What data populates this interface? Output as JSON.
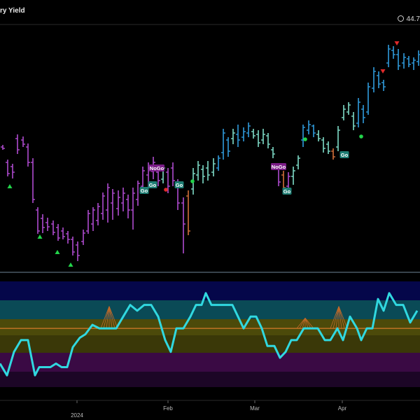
{
  "chart": {
    "title": "ry Yield",
    "last_value": "44.7"
  },
  "chart_data": [
    {
      "type": "ohlc",
      "panel": "price",
      "title": "ry Yield",
      "x_ticks": [
        "2024",
        "Feb",
        "Mar",
        "Apr"
      ],
      "bars": [
        {
          "c": "purple",
          "lo": 214,
          "hi": 207,
          "o": 210,
          "cl": 212
        },
        {
          "c": "purple",
          "lo": 252,
          "hi": 228,
          "o": 232,
          "cl": 248
        },
        {
          "c": "purple",
          "lo": 255,
          "hi": 234,
          "o": 238,
          "cl": 246
        },
        {
          "c": "purple",
          "lo": 220,
          "hi": 192,
          "o": 198,
          "cl": 214
        },
        {
          "c": "purple",
          "lo": 210,
          "hi": 195,
          "o": 200,
          "cl": 206
        },
        {
          "c": "purple",
          "lo": 238,
          "hi": 205,
          "o": 210,
          "cl": 232
        },
        {
          "c": "purple",
          "lo": 290,
          "hi": 226,
          "o": 232,
          "cl": 285
        },
        {
          "c": "purple",
          "lo": 334,
          "hi": 296,
          "o": 300,
          "cl": 330
        },
        {
          "c": "purple",
          "lo": 333,
          "hi": 306,
          "o": 312,
          "cl": 325
        },
        {
          "c": "purple",
          "lo": 330,
          "hi": 311,
          "o": 318,
          "cl": 324
        },
        {
          "c": "purple",
          "lo": 336,
          "hi": 315,
          "o": 320,
          "cl": 332
        },
        {
          "c": "purple",
          "lo": 344,
          "hi": 320,
          "o": 325,
          "cl": 340
        },
        {
          "c": "purple",
          "lo": 342,
          "hi": 325,
          "o": 330,
          "cl": 338
        },
        {
          "c": "purple",
          "lo": 348,
          "hi": 330,
          "o": 334,
          "cl": 342
        },
        {
          "c": "purple",
          "lo": 365,
          "hi": 338,
          "o": 342,
          "cl": 360
        },
        {
          "c": "purple",
          "lo": 373,
          "hi": 345,
          "o": 350,
          "cl": 365
        },
        {
          "c": "purple",
          "lo": 350,
          "hi": 328,
          "o": 345,
          "cl": 333
        },
        {
          "c": "purple",
          "lo": 334,
          "hi": 300,
          "o": 330,
          "cl": 305
        },
        {
          "c": "purple",
          "lo": 330,
          "hi": 296,
          "o": 320,
          "cl": 300
        },
        {
          "c": "purple",
          "lo": 322,
          "hi": 290,
          "o": 315,
          "cl": 295
        },
        {
          "c": "purple",
          "lo": 314,
          "hi": 275,
          "o": 305,
          "cl": 280
        },
        {
          "c": "purple",
          "lo": 318,
          "hi": 262,
          "o": 300,
          "cl": 268
        },
        {
          "c": "purple",
          "lo": 314,
          "hi": 270,
          "o": 290,
          "cl": 276
        },
        {
          "c": "purple",
          "lo": 308,
          "hi": 272,
          "o": 298,
          "cl": 282
        },
        {
          "c": "purple",
          "lo": 302,
          "hi": 268,
          "o": 290,
          "cl": 276
        },
        {
          "c": "purple",
          "lo": 312,
          "hi": 278,
          "o": 285,
          "cl": 300
        },
        {
          "c": "purple",
          "lo": 328,
          "hi": 268,
          "o": 300,
          "cl": 276
        },
        {
          "c": "purple",
          "lo": 294,
          "hi": 258,
          "o": 285,
          "cl": 262
        },
        {
          "c": "purple",
          "lo": 275,
          "hi": 238,
          "o": 266,
          "cl": 244
        },
        {
          "c": "purple",
          "lo": 268,
          "hi": 232,
          "o": 250,
          "cl": 240
        },
        {
          "c": "purple",
          "lo": 256,
          "hi": 224,
          "o": 245,
          "cl": 232
        },
        {
          "c": "purple",
          "lo": 266,
          "hi": 240,
          "o": 246,
          "cl": 258
        },
        {
          "c": "teal",
          "lo": 262,
          "hi": 236,
          "o": 256,
          "cl": 240
        },
        {
          "c": "purple",
          "lo": 276,
          "hi": 240,
          "o": 246,
          "cl": 266
        },
        {
          "c": "purple",
          "lo": 266,
          "hi": 232,
          "o": 240,
          "cl": 258
        },
        {
          "c": "purple",
          "lo": 300,
          "hi": 256,
          "o": 260,
          "cl": 290
        },
        {
          "c": "purple",
          "lo": 362,
          "hi": 282,
          "o": 290,
          "cl": 320
        },
        {
          "c": "orange",
          "lo": 336,
          "hi": 272,
          "o": 280,
          "cl": 330
        },
        {
          "c": "teal",
          "lo": 278,
          "hi": 240,
          "o": 270,
          "cl": 248
        },
        {
          "c": "teal",
          "lo": 258,
          "hi": 230,
          "o": 250,
          "cl": 236
        },
        {
          "c": "teal",
          "lo": 262,
          "hi": 236,
          "o": 242,
          "cl": 252
        },
        {
          "c": "teal",
          "lo": 258,
          "hi": 230,
          "o": 240,
          "cl": 250
        },
        {
          "c": "teal",
          "lo": 252,
          "hi": 226,
          "o": 246,
          "cl": 234
        },
        {
          "c": "blue",
          "lo": 244,
          "hi": 222,
          "o": 240,
          "cl": 226
        },
        {
          "c": "blue",
          "lo": 228,
          "hi": 184,
          "o": 218,
          "cl": 190
        },
        {
          "c": "blue",
          "lo": 224,
          "hi": 196,
          "o": 200,
          "cl": 216
        },
        {
          "c": "teal",
          "lo": 206,
          "hi": 184,
          "o": 198,
          "cl": 190
        },
        {
          "c": "blue",
          "lo": 210,
          "hi": 178,
          "o": 192,
          "cl": 200
        },
        {
          "c": "blue",
          "lo": 202,
          "hi": 182,
          "o": 196,
          "cl": 188
        },
        {
          "c": "blue",
          "lo": 196,
          "hi": 175,
          "o": 190,
          "cl": 180
        },
        {
          "c": "teal",
          "lo": 198,
          "hi": 184,
          "o": 188,
          "cl": 194
        },
        {
          "c": "teal",
          "lo": 210,
          "hi": 186,
          "o": 192,
          "cl": 204
        },
        {
          "c": "teal",
          "lo": 206,
          "hi": 184,
          "o": 200,
          "cl": 192
        },
        {
          "c": "teal",
          "lo": 212,
          "hi": 190,
          "o": 194,
          "cl": 206
        },
        {
          "c": "teal",
          "lo": 226,
          "hi": 210,
          "o": 214,
          "cl": 220
        },
        {
          "c": "purple",
          "lo": 266,
          "hi": 234,
          "o": 240,
          "cl": 260
        },
        {
          "c": "orange",
          "lo": 276,
          "hi": 244,
          "o": 250,
          "cl": 268
        },
        {
          "c": "purple",
          "lo": 272,
          "hi": 246,
          "o": 266,
          "cl": 252
        },
        {
          "c": "teal",
          "lo": 264,
          "hi": 238,
          "o": 252,
          "cl": 244
        },
        {
          "c": "teal",
          "lo": 242,
          "hi": 222,
          "o": 236,
          "cl": 226
        },
        {
          "c": "blue",
          "lo": 210,
          "hi": 178,
          "o": 200,
          "cl": 182
        },
        {
          "c": "blue",
          "lo": 192,
          "hi": 172,
          "o": 186,
          "cl": 178
        },
        {
          "c": "blue",
          "lo": 196,
          "hi": 178,
          "o": 180,
          "cl": 190
        },
        {
          "c": "teal",
          "lo": 202,
          "hi": 186,
          "o": 192,
          "cl": 198
        },
        {
          "c": "teal",
          "lo": 218,
          "hi": 196,
          "o": 200,
          "cl": 212
        },
        {
          "c": "teal",
          "lo": 220,
          "hi": 202,
          "o": 206,
          "cl": 216
        },
        {
          "c": "orange",
          "lo": 228,
          "hi": 212,
          "o": 216,
          "cl": 224
        },
        {
          "c": "teal",
          "lo": 216,
          "hi": 180,
          "o": 210,
          "cl": 186
        },
        {
          "c": "teal",
          "lo": 172,
          "hi": 150,
          "o": 168,
          "cl": 156
        },
        {
          "c": "teal",
          "lo": 164,
          "hi": 146,
          "o": 160,
          "cl": 150
        },
        {
          "c": "teal",
          "lo": 186,
          "hi": 160,
          "o": 166,
          "cl": 180
        },
        {
          "c": "blue",
          "lo": 182,
          "hi": 140,
          "o": 176,
          "cl": 146
        },
        {
          "c": "blue",
          "lo": 176,
          "hi": 150,
          "o": 156,
          "cl": 168
        },
        {
          "c": "blue",
          "lo": 164,
          "hi": 118,
          "o": 160,
          "cl": 124
        },
        {
          "c": "blue",
          "lo": 132,
          "hi": 96,
          "o": 126,
          "cl": 102
        },
        {
          "c": "blue",
          "lo": 126,
          "hi": 102,
          "o": 108,
          "cl": 120
        },
        {
          "c": "blue",
          "lo": 130,
          "hi": 114,
          "o": 118,
          "cl": 124
        },
        {
          "c": "blue",
          "lo": 96,
          "hi": 64,
          "o": 90,
          "cl": 70
        },
        {
          "c": "blue",
          "lo": 84,
          "hi": 66,
          "o": 72,
          "cl": 78
        },
        {
          "c": "blue",
          "lo": 100,
          "hi": 70,
          "o": 78,
          "cl": 94
        },
        {
          "c": "blue",
          "lo": 98,
          "hi": 76,
          "o": 90,
          "cl": 82
        },
        {
          "c": "blue",
          "lo": 96,
          "hi": 80,
          "o": 84,
          "cl": 92
        },
        {
          "c": "blue",
          "lo": 100,
          "hi": 82,
          "o": 90,
          "cl": 86
        },
        {
          "c": "blue",
          "lo": 94,
          "hi": 72,
          "o": 88,
          "cl": 78
        }
      ],
      "markers": {
        "triangles_up": [
          [
            14,
            266
          ],
          [
            57,
            338
          ],
          [
            82,
            360
          ],
          [
            101,
            378
          ]
        ],
        "triangles_down": [
          [
            567,
            62
          ],
          [
            547,
            102
          ]
        ],
        "dots_green": [
          [
            275,
            259
          ],
          [
            436,
            199
          ],
          [
            516,
            195
          ]
        ],
        "dots_red": [
          [
            237,
            271
          ]
        ],
        "labels": [
          {
            "text": "NoGo",
            "x": 224,
            "y": 240,
            "kind": "nogo"
          },
          {
            "text": "Go",
            "x": 218,
            "y": 264,
            "kind": "go"
          },
          {
            "text": "Go",
            "x": 206,
            "y": 272,
            "kind": "go"
          },
          {
            "text": "Go",
            "x": 256,
            "y": 264,
            "kind": "go"
          },
          {
            "text": "NoGo",
            "x": 398,
            "y": 238,
            "kind": "nogo"
          },
          {
            "text": "Go",
            "x": 410,
            "y": 273,
            "kind": "go"
          },
          {
            "text": "Go",
            "x": 492,
            "y": 221,
            "kind": "go"
          }
        ]
      }
    },
    {
      "type": "line",
      "panel": "oscillator",
      "zero_line": true,
      "bands": [
        {
          "name": "upper",
          "color": "#05074a"
        },
        {
          "name": "upper-mid",
          "color": "#0a4a56"
        },
        {
          "name": "mid-up",
          "color": "#4c4a0a"
        },
        {
          "name": "mid-low",
          "color": "#3a3808"
        },
        {
          "name": "lower-mid",
          "color": "#3a0a44"
        },
        {
          "name": "lower",
          "color": "#1c0626"
        }
      ],
      "line_color": "#30d8e0",
      "values": [
        [
          0,
          -3
        ],
        [
          10,
          -4
        ],
        [
          20,
          -2
        ],
        [
          30,
          -1
        ],
        [
          40,
          -1
        ],
        [
          50,
          -4
        ],
        [
          56,
          -3.3
        ],
        [
          64,
          -3.3
        ],
        [
          72,
          -3.3
        ],
        [
          80,
          -3
        ],
        [
          88,
          -3.3
        ],
        [
          96,
          -3.3
        ],
        [
          104,
          -1.6
        ],
        [
          114,
          -0.8
        ],
        [
          122,
          -0.5
        ],
        [
          132,
          0.3
        ],
        [
          142,
          0
        ],
        [
          150,
          0
        ],
        [
          158,
          0
        ],
        [
          166,
          0
        ],
        [
          176,
          1
        ],
        [
          186,
          2
        ],
        [
          196,
          1.5
        ],
        [
          206,
          2
        ],
        [
          216,
          2
        ],
        [
          226,
          1
        ],
        [
          236,
          -1
        ],
        [
          244,
          -2
        ],
        [
          252,
          0
        ],
        [
          262,
          0
        ],
        [
          272,
          1
        ],
        [
          280,
          2
        ],
        [
          288,
          2
        ],
        [
          294,
          3
        ],
        [
          302,
          2
        ],
        [
          312,
          2
        ],
        [
          322,
          2
        ],
        [
          332,
          2
        ],
        [
          340,
          1
        ],
        [
          348,
          0
        ],
        [
          358,
          1
        ],
        [
          366,
          1
        ],
        [
          374,
          0
        ],
        [
          382,
          -1.5
        ],
        [
          392,
          -1.5
        ],
        [
          400,
          -2.5
        ],
        [
          408,
          -2
        ],
        [
          416,
          -1
        ],
        [
          424,
          -1
        ],
        [
          434,
          0
        ],
        [
          444,
          0
        ],
        [
          454,
          0
        ],
        [
          464,
          -1
        ],
        [
          472,
          -1
        ],
        [
          482,
          0
        ],
        [
          490,
          -1
        ],
        [
          500,
          1
        ],
        [
          510,
          0
        ],
        [
          516,
          -1
        ],
        [
          524,
          0
        ],
        [
          532,
          0
        ],
        [
          540,
          2.5
        ],
        [
          548,
          1.5
        ],
        [
          556,
          3
        ],
        [
          566,
          2
        ],
        [
          576,
          2
        ],
        [
          586,
          0.5
        ],
        [
          596,
          1.5
        ]
      ],
      "y_range": [
        -5,
        4
      ]
    }
  ]
}
